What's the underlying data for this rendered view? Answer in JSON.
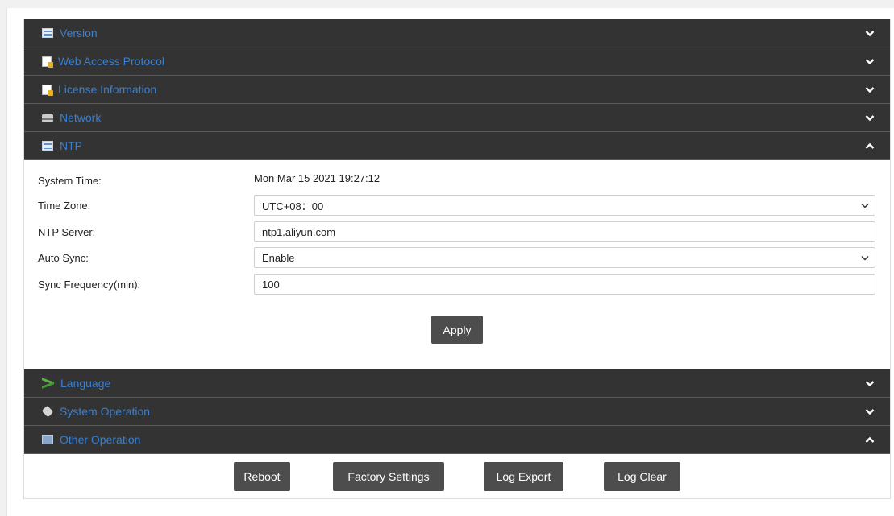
{
  "sections_top": [
    {
      "id": "version",
      "title": "Version",
      "icon": "table-icon",
      "expanded": false
    },
    {
      "id": "web-access",
      "title": "Web Access Protocol",
      "icon": "document-icon",
      "expanded": false
    },
    {
      "id": "license",
      "title": "License Information",
      "icon": "document-icon",
      "expanded": false
    },
    {
      "id": "network",
      "title": "Network",
      "icon": "network-icon",
      "expanded": false
    },
    {
      "id": "ntp",
      "title": "NTP",
      "icon": "table-icon",
      "expanded": true
    }
  ],
  "ntp": {
    "system_time_label": "System Time:",
    "system_time_value": "Mon Mar 15 2021 19:27:12",
    "time_zone_label": "Time Zone:",
    "time_zone_value": "UTC+08：00",
    "ntp_server_label": "NTP Server:",
    "ntp_server_value": "ntp1.aliyun.com",
    "auto_sync_label": "Auto Sync:",
    "auto_sync_value": "Enable",
    "sync_freq_label": "Sync Frequency(min):",
    "sync_freq_value": "100",
    "apply_label": "Apply"
  },
  "sections_bottom": [
    {
      "id": "language",
      "title": "Language",
      "icon": "language-icon",
      "expanded": false
    },
    {
      "id": "system-operation",
      "title": "System Operation",
      "icon": "cube-icon",
      "expanded": false
    },
    {
      "id": "other-operation",
      "title": "Other Operation",
      "icon": "monitor-icon",
      "expanded": true
    }
  ],
  "other_operation": {
    "reboot_label": "Reboot",
    "factory_label": "Factory Settings",
    "log_export_label": "Log Export",
    "log_clear_label": "Log Clear"
  },
  "colors": {
    "header_bg": "#333333",
    "header_title": "#3a7fd0",
    "button_bg": "#4d4d4d"
  }
}
